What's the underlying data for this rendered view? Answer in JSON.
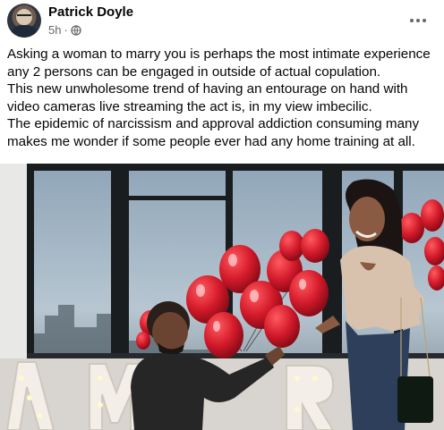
{
  "post": {
    "author": "Patrick Doyle",
    "time": "5h",
    "separator": "·",
    "privacy_icon": "globe-icon",
    "more_icon": "more-options-icon",
    "lines": [
      "Asking a woman to marry you is perhaps the most intimate experience",
      "any 2 persons can be engaged in outside of actual copulation.",
      "This new unwholesome trend of having an entourage on hand with",
      "video cameras live streaming the act is, in my view imbecilic.",
      "The epidemic of narcissism and approval addiction consuming many",
      "makes me wonder if some people ever had any home training at all."
    ]
  },
  "colors": {
    "text_primary": "#050505",
    "text_secondary": "#65676b",
    "balloon_red": "#d31a2a"
  }
}
